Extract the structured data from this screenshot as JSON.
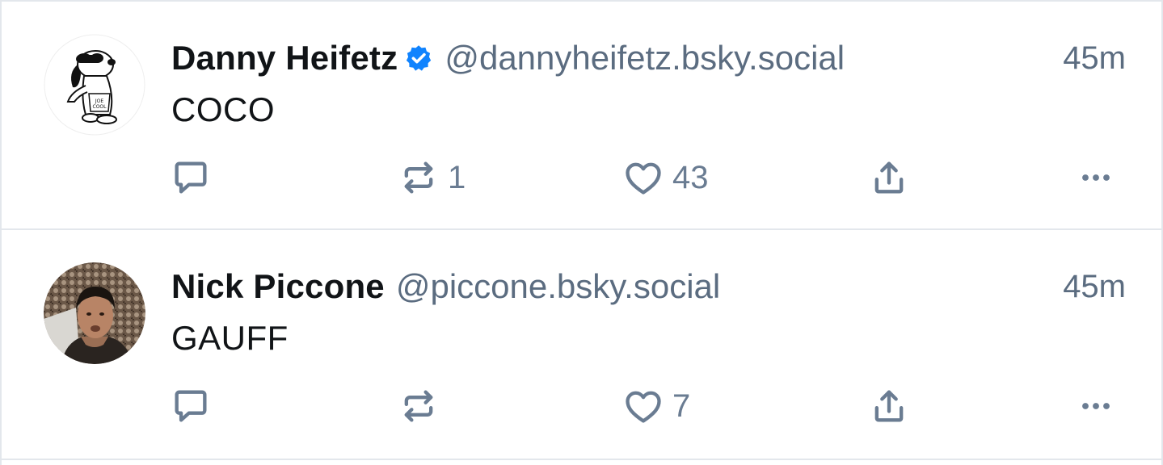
{
  "posts": [
    {
      "author": {
        "display_name": "Danny Heifetz",
        "verified": true,
        "handle": "@dannyheifetz.bsky.social",
        "avatar": "snoopy-joe-cool-avatar"
      },
      "timestamp": "45m",
      "text": "COCO",
      "actions": {
        "reply_count": "",
        "repost_count": "1",
        "like_count": "43"
      }
    },
    {
      "author": {
        "display_name": "Nick Piccone",
        "verified": false,
        "handle": "@piccone.bsky.social",
        "avatar": "photo-avatar"
      },
      "timestamp": "45m",
      "text": "GAUFF",
      "actions": {
        "reply_count": "",
        "repost_count": "",
        "like_count": "7"
      }
    }
  ],
  "icons": {
    "reply": "reply-icon",
    "repost": "repost-icon",
    "like": "heart-icon",
    "share": "share-icon",
    "more": "more-options-icon",
    "verified": "verified-check-icon"
  },
  "colors": {
    "text": "#111417",
    "secondary": "#5b6c80",
    "icon": "#6a7c92",
    "verified": "#1083fe",
    "divider": "#e3e7ec"
  }
}
